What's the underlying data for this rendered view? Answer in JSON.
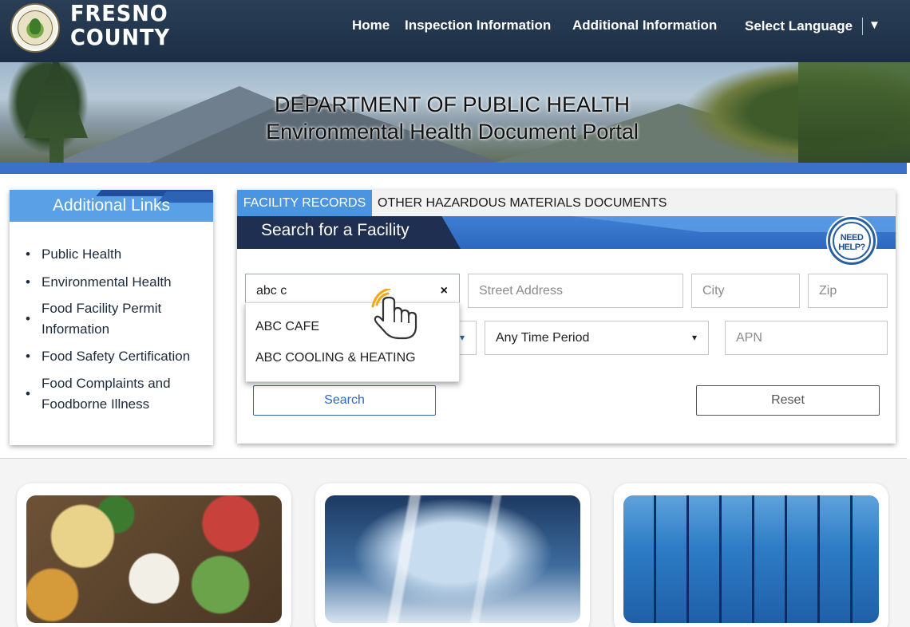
{
  "header": {
    "logo_text_line1": "FRESNO",
    "logo_text_line2": "COUNTY",
    "nav": [
      "Home",
      "Inspection Information",
      "Additional Information"
    ],
    "language_label": "Select Language",
    "language_caret": "▼"
  },
  "banner": {
    "title_line1": "DEPARTMENT OF PUBLIC HEALTH",
    "title_line2": "Environmental Health Document Portal"
  },
  "sidebar": {
    "title": "Additional Links",
    "links": [
      "Public Health",
      "Environmental Health",
      "Food Facility Permit Information",
      "Food Safety Certification",
      "Food Complaints and Foodborne Illness"
    ]
  },
  "panel": {
    "tabs": [
      "FACILITY RECORDS",
      "OTHER HAZARDOUS MATERIALS DOCUMENTS"
    ],
    "search_title": "Search for a Facility",
    "help_badge": "NEED HELP?",
    "name_input_value": "abc c",
    "clear_symbol": "×",
    "street_placeholder": "Street Address",
    "city_placeholder": "City",
    "zip_placeholder": "Zip",
    "time_period_selected": "Any Time Period",
    "apn_placeholder": "APN",
    "search_button": "Search",
    "reset_button": "Reset",
    "suggestions": [
      "ABC CAFE",
      "ABC COOLING & HEATING"
    ]
  },
  "icons": {
    "select_caret": "▾"
  },
  "colors": {
    "header_bg": "#1b2e45",
    "accent_blue": "#3a72c8",
    "tab_active": "#4b95e0",
    "sidebar_head": "#5aa0e6",
    "navy": "#1e2f52"
  }
}
